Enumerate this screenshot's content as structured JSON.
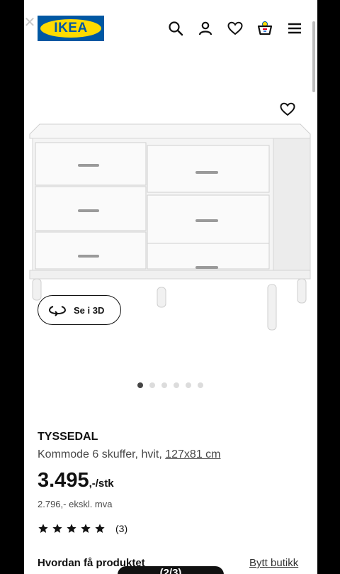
{
  "header": {
    "logo_text": "IKEA",
    "icons": [
      "search-icon",
      "account-icon",
      "wishlist-heart-icon",
      "cart-icon",
      "menu-icon"
    ]
  },
  "gallery": {
    "view_3d_label": "Se i 3D",
    "dot_count": 6,
    "active_dot": 0
  },
  "product": {
    "name": "TYSSEDAL",
    "description": "Kommode 6 skuffer, hvit, ",
    "size": "127x81 cm",
    "price": "3.495",
    "price_suffix": ",-/stk",
    "price_excl_vat": "2.796,- ekskl. mva",
    "rating_stars": 5,
    "review_count": "(3)"
  },
  "delivery": {
    "heading": "Hvordan få produktet",
    "change_store": "Bytt butikk"
  },
  "pager": {
    "label": "(2/3)"
  },
  "colors": {
    "ikea_blue": "#0058a3",
    "ikea_yellow": "#ffdb00",
    "text": "#111111"
  }
}
